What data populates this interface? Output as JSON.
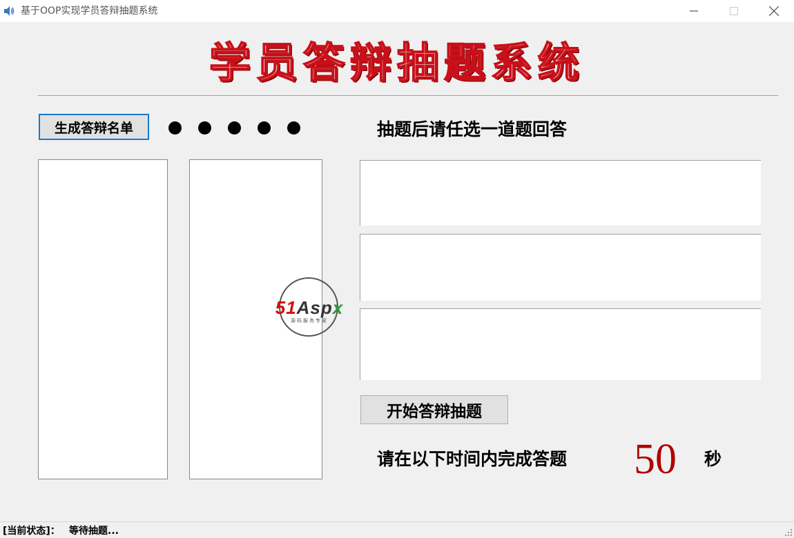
{
  "window": {
    "title": "基于OOP实现学员答辩抽题系统",
    "icons": {
      "app": "speaker-icon",
      "minimize": "minimize-icon",
      "maximize": "maximize-icon",
      "close": "close-icon"
    }
  },
  "banner": {
    "title": "学员答辩抽题系统",
    "fill_color": "#ffffff",
    "outline_color": "#c8101a"
  },
  "controls": {
    "generate_label": "生成答辩名单",
    "start_label": "开始答辩抽题"
  },
  "dots": {
    "count": 5,
    "color": "#000000"
  },
  "questions": {
    "prompt": "抽题后请任选一道题回答",
    "boxes": [
      "",
      "",
      ""
    ]
  },
  "timer": {
    "label": "请在以下时间内完成答题",
    "value": "50",
    "unit": "秒",
    "value_color": "#b00000"
  },
  "watermark": {
    "brand_red": "51",
    "brand_main": "Asp",
    "brand_green": "x",
    "tagline": "源码服务专家"
  },
  "status": {
    "label": "[当前状态]：",
    "value": "等待抽题..."
  }
}
